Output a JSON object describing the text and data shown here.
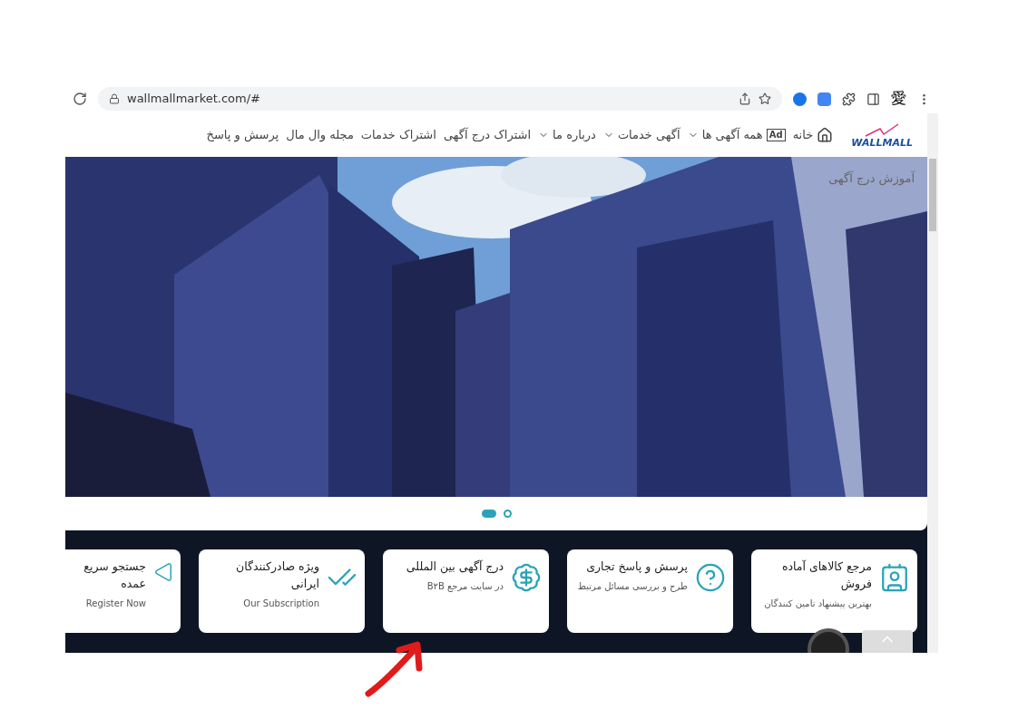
{
  "browser": {
    "url": "wallmallmarket.com/#",
    "extension_label": "愛"
  },
  "nav": {
    "logo": "WALLMALL",
    "items": [
      {
        "label": "خانه",
        "kind": "home"
      },
      {
        "label": "همه آگهی ها",
        "kind": "ad",
        "badge": "Ad"
      },
      {
        "label": "آگهی خدمات",
        "kind": "dropdown"
      },
      {
        "label": "درباره ما",
        "kind": "dropdown"
      },
      {
        "label": "اشتراک درج آگهی",
        "kind": "plain"
      },
      {
        "label": "اشتراک خدمات",
        "kind": "plain"
      },
      {
        "label": "مجله وال مال",
        "kind": "plain"
      },
      {
        "label": "پرسش و پاسخ",
        "kind": "plain"
      }
    ]
  },
  "hero": {
    "caption": "آموزش درج آگهی",
    "slides": [
      {
        "selected": true
      },
      {
        "selected": false
      }
    ]
  },
  "cards": [
    {
      "kind": "id-card",
      "title": "مرجع کالاهای آماده فروش",
      "subtitle": "بهترین پیشنهاد تامین کنندگان"
    },
    {
      "kind": "question",
      "title": "پرسش و پاسخ تجاری",
      "subtitle": "طرح و بررسی مسائل مرتبط"
    },
    {
      "kind": "dollar",
      "title": "درج آگهی بین المللی",
      "subtitle": "در سایت مرجع B۲B"
    },
    {
      "kind": "check",
      "title": "ویژه صادرکنندگان ایرانی",
      "subtitle": "Our Subscription"
    },
    {
      "kind": "triangle",
      "title": "جستجو سریع عمده",
      "subtitle": "Register Now"
    }
  ]
}
